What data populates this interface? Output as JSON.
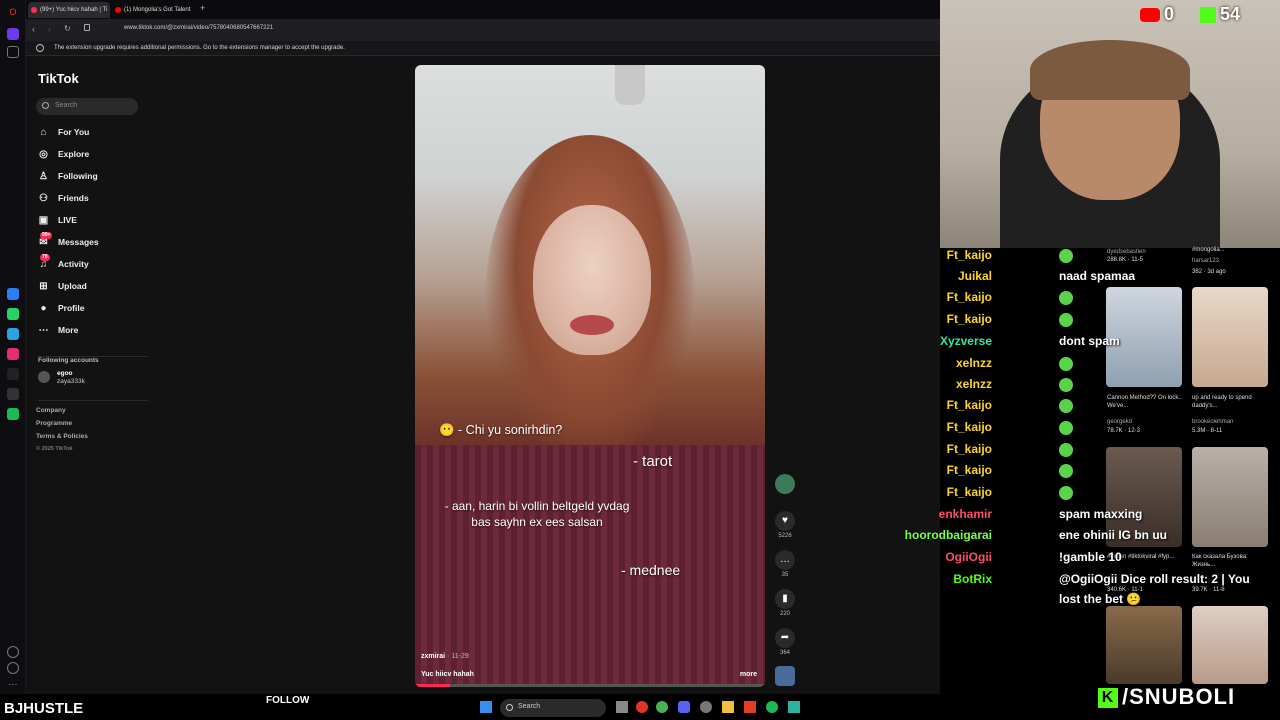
{
  "tabs": [
    {
      "label": "(99+) Yuc hiicv hahah | Ti",
      "color": "#fe2c55"
    },
    {
      "label": "(1) Mongolia's Got Talent",
      "color": "#ff0000"
    }
  ],
  "new_tab": "+",
  "url": "www.tiktok.com/@zxmirai/video/7578040680547667221",
  "notice": "The extension upgrade requires additional permissions. Go to the extensions manager to accept the upgrade.",
  "tiktok": {
    "logo": "TikTok",
    "search_placeholder": "Search",
    "nav": [
      {
        "label": "For You",
        "icon": "home-icon"
      },
      {
        "label": "Explore",
        "icon": "compass-icon"
      },
      {
        "label": "Following",
        "icon": "person-icon"
      },
      {
        "label": "Friends",
        "icon": "friends-icon"
      },
      {
        "label": "LIVE",
        "icon": "live-icon"
      },
      {
        "label": "Messages",
        "icon": "messages-icon",
        "badge": "99+"
      },
      {
        "label": "Activity",
        "icon": "bell-icon",
        "badge": "70"
      },
      {
        "label": "Upload",
        "icon": "plus-icon"
      },
      {
        "label": "Profile",
        "icon": "avatar-icon"
      },
      {
        "label": "More",
        "icon": "dots-icon"
      }
    ],
    "following_title": "Following accounts",
    "following": {
      "name": "egoo",
      "handle": "zaya333k"
    },
    "footer": [
      "Company",
      "Programme",
      "Terms & Policies",
      "© 2025 TikTok"
    ]
  },
  "video": {
    "captions": [
      "😶 - Chi yu sonirhdin?",
      "- tarot",
      "- aan, harin bi vollin beltgeld yvdag bas sayhn ex ees salsan",
      "- mednee"
    ],
    "author": "zxmirai",
    "date": "· 11-29",
    "description": "Yuc hiicv hahah",
    "more": "more",
    "progress": 0.1
  },
  "actions": [
    {
      "name": "like-icon",
      "count": "5226"
    },
    {
      "name": "comment-icon",
      "count": "35"
    },
    {
      "name": "bookmark-icon",
      "count": "220"
    },
    {
      "name": "share-icon",
      "count": "364"
    }
  ],
  "stream": {
    "youtube_count": "0",
    "kick_count": "54",
    "streamer": "BJHUSTLE",
    "follow": "FOLLOW",
    "brand": "/SNUBOLI",
    "chat": [
      {
        "user": "Ft_kaijo",
        "text": "",
        "color": "#ffd42a"
      },
      {
        "user": "Juikal",
        "text": "naad spamaa",
        "color": "#ffd42a"
      },
      {
        "user": "Ft_kaijo",
        "text": "",
        "color": "#ffd42a"
      },
      {
        "user": "Ft_kaijo",
        "text": "",
        "color": "#ffd42a"
      },
      {
        "user": "Xyzverse",
        "text": "dont spam",
        "color": "#2ee6a8"
      },
      {
        "user": "xelnzz",
        "text": "",
        "color": "#ffd42a"
      },
      {
        "user": "xelnzz",
        "text": "",
        "color": "#ffd42a"
      },
      {
        "user": "Ft_kaijo",
        "text": "",
        "color": "#ffd42a"
      },
      {
        "user": "Ft_kaijo",
        "text": "",
        "color": "#ffd42a"
      },
      {
        "user": "Ft_kaijo",
        "text": "",
        "color": "#ffd42a"
      },
      {
        "user": "Ft_kaijo",
        "text": "",
        "color": "#ffd42a"
      },
      {
        "user": "Ft_kaijo",
        "text": "",
        "color": "#ffd42a"
      },
      {
        "user": "enkhamir",
        "text": "spam maxxing",
        "color": "#ff4d6a"
      },
      {
        "user": "hoorodbaigarai",
        "text": "ene ohinii IG bn uu",
        "color": "#7cff4a"
      },
      {
        "user": "OgiiOgii",
        "text": "!gamble 10",
        "color": "#ff4d6a"
      },
      {
        "user": "BotRix",
        "text": "@OgiiOgii Dice roll result: 2 | You",
        "color": "#53fc18"
      }
    ],
    "chat_continuation": "lost the bet 😕"
  },
  "thumbs": [
    {
      "title": "",
      "author": "dyedsebastien",
      "likes": "288.8K · 11-5"
    },
    {
      "title": "#mongolia...",
      "author": "harsar123",
      "likes": "382 · 3d ago"
    },
    {
      "title": "Cannon Method?? On lock.. We've...",
      "author": "georgekd",
      "likes": "78.7K · 12-3"
    },
    {
      "title": "up and ready to spend daddy's...",
      "author": "brookeolehman",
      "likes": "5.3M · 8-11"
    },
    {
      "title": "#indian #tiktokviral #fyp...",
      "author": "",
      "likes": "340.6K · 11-1"
    },
    {
      "title": "Как сказала Бузова: Жизнь...",
      "author": "",
      "likes": "39.7K · 11-8"
    }
  ]
}
